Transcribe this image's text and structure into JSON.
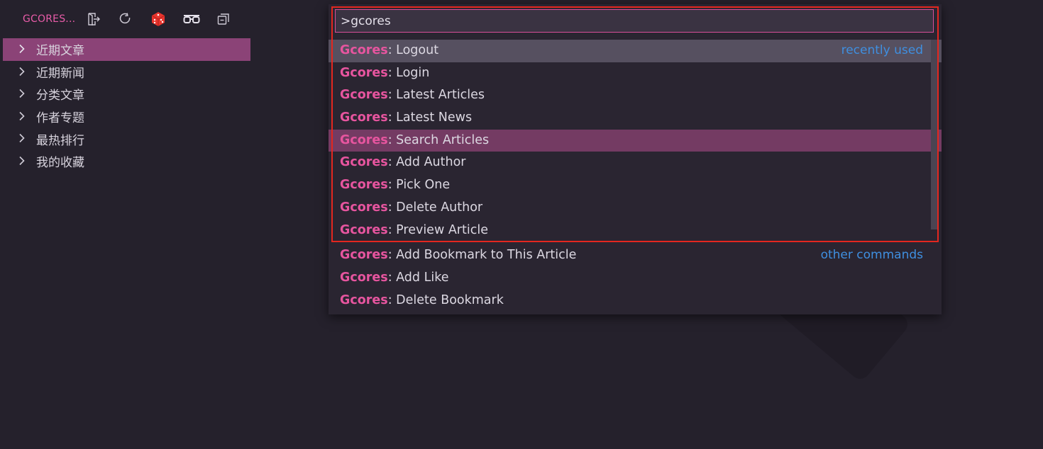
{
  "sidebar": {
    "title": "GCORES...",
    "header_icons": [
      "logout-icon",
      "refresh-icon",
      "dice-icon",
      "glasses-icon",
      "collapse-all-icon"
    ],
    "items": [
      {
        "label": "近期文章",
        "selected": true
      },
      {
        "label": "近期新闻"
      },
      {
        "label": "分类文章"
      },
      {
        "label": "作者专题"
      },
      {
        "label": "最热排行"
      },
      {
        "label": "我的收藏"
      }
    ]
  },
  "palette": {
    "input_value": ">gcores",
    "prefix": "Gcores",
    "commands": [
      {
        "rest": ": Logout",
        "tag": "recently used"
      },
      {
        "rest": ": Login"
      },
      {
        "rest": ": Latest Articles"
      },
      {
        "rest": ": Latest News"
      },
      {
        "rest": ": Search Articles"
      },
      {
        "rest": ": Add Author"
      },
      {
        "rest": ": Pick One"
      },
      {
        "rest": ": Delete Author"
      },
      {
        "rest": ": Preview Article"
      },
      {
        "rest": ": Add Bookmark to This Article",
        "tag": "other commands"
      },
      {
        "rest": ": Add Like"
      },
      {
        "rest": ": Delete Bookmark"
      }
    ]
  },
  "colors": {
    "accent": "#e7559f",
    "selection": "#8b4377",
    "active_row": "#743b63",
    "link_blue": "#3f8fe0",
    "highlight_frame": "#e3271f"
  }
}
